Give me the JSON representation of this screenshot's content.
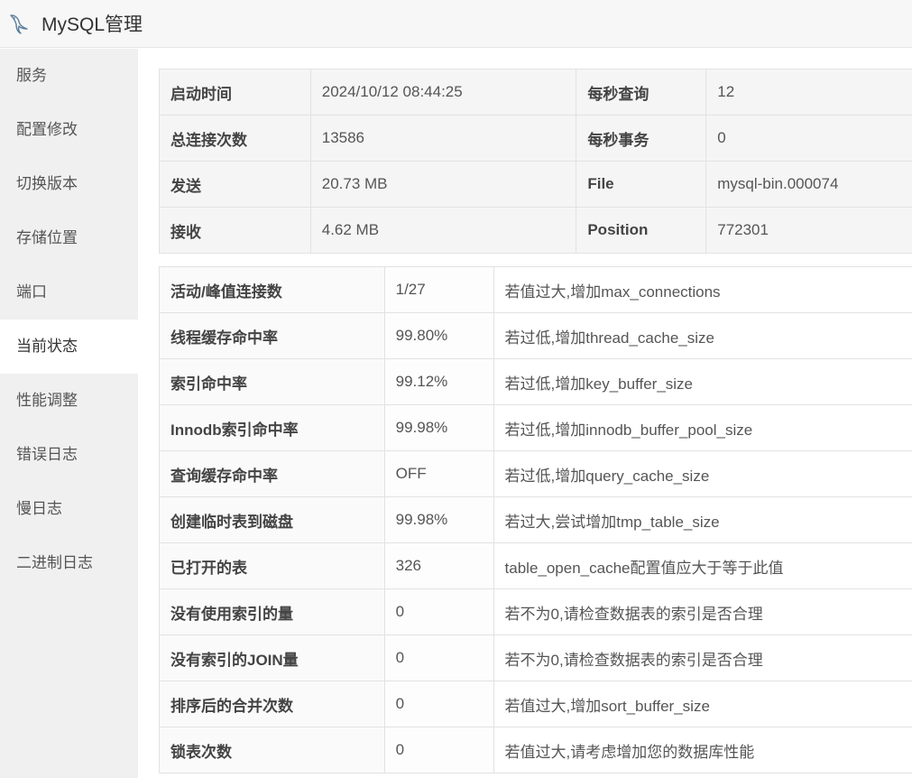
{
  "header": {
    "title": "MySQL管理",
    "icon": "mysql-dolphin-icon"
  },
  "sidebar": {
    "items": [
      {
        "label": "服务"
      },
      {
        "label": "配置修改"
      },
      {
        "label": "切换版本"
      },
      {
        "label": "存储位置"
      },
      {
        "label": "端口"
      },
      {
        "label": "当前状态",
        "active": true
      },
      {
        "label": "性能调整"
      },
      {
        "label": "错误日志"
      },
      {
        "label": "慢日志"
      },
      {
        "label": "二进制日志"
      }
    ]
  },
  "status_summary": {
    "rows": [
      {
        "l1": "启动时间",
        "v1": "2024/10/12 08:44:25",
        "l2": "每秒查询",
        "v2": "12"
      },
      {
        "l1": "总连接次数",
        "v1": "13586",
        "l2": "每秒事务",
        "v2": "0"
      },
      {
        "l1": "发送",
        "v1": "20.73 MB",
        "l2": "File",
        "v2": "mysql-bin.000074"
      },
      {
        "l1": "接收",
        "v1": "4.62 MB",
        "l2": "Position",
        "v2": "772301"
      }
    ]
  },
  "metrics": {
    "rows": [
      {
        "name": "活动/峰值连接数",
        "value": "1/27",
        "tip": "若值过大,增加max_connections"
      },
      {
        "name": "线程缓存命中率",
        "value": "99.80%",
        "tip": "若过低,增加thread_cache_size"
      },
      {
        "name": "索引命中率",
        "value": "99.12%",
        "tip": "若过低,增加key_buffer_size"
      },
      {
        "name": "Innodb索引命中率",
        "value": "99.98%",
        "tip": "若过低,增加innodb_buffer_pool_size"
      },
      {
        "name": "查询缓存命中率",
        "value": "OFF",
        "tip": "若过低,增加query_cache_size"
      },
      {
        "name": "创建临时表到磁盘",
        "value": "99.98%",
        "tip": "若过大,尝试增加tmp_table_size"
      },
      {
        "name": "已打开的表",
        "value": "326",
        "tip": "table_open_cache配置值应大于等于此值"
      },
      {
        "name": "没有使用索引的量",
        "value": "0",
        "tip": "若不为0,请检查数据表的索引是否合理"
      },
      {
        "name": "没有索引的JOIN量",
        "value": "0",
        "tip": "若不为0,请检查数据表的索引是否合理"
      },
      {
        "name": "排序后的合并次数",
        "value": "0",
        "tip": "若值过大,增加sort_buffer_size"
      },
      {
        "name": "锁表次数",
        "value": "0",
        "tip": "若值过大,请考虑增加您的数据库性能"
      }
    ]
  }
}
